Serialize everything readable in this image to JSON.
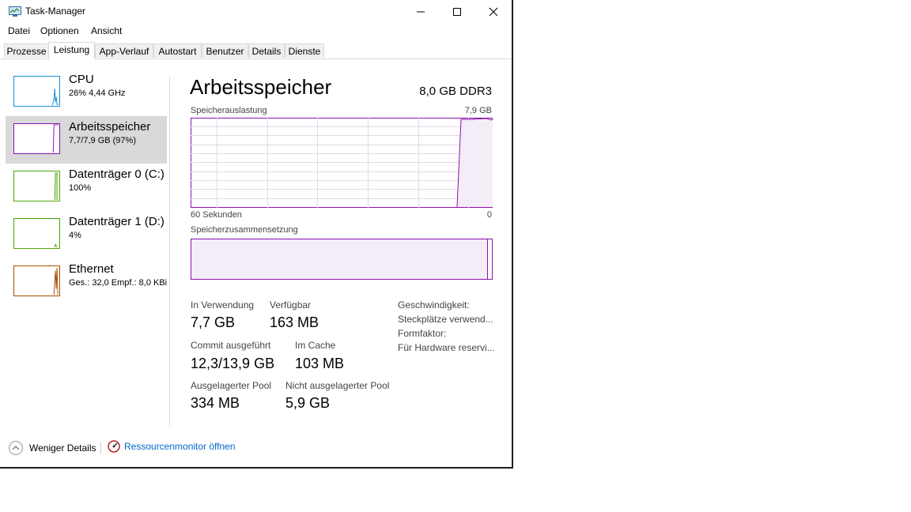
{
  "window": {
    "title": "Task-Manager",
    "icon": "task-manager-icon",
    "controls": [
      "minimize-icon",
      "maximize-icon",
      "close-icon"
    ]
  },
  "menu": {
    "file": "Datei",
    "options": "Optionen",
    "view": "Ansicht"
  },
  "tabs": [
    {
      "label": "Prozesse",
      "active": false
    },
    {
      "label": "Leistung",
      "active": true
    },
    {
      "label": "App-Verlauf",
      "active": false
    },
    {
      "label": "Autostart",
      "active": false
    },
    {
      "label": "Benutzer",
      "active": false
    },
    {
      "label": "Details",
      "active": false
    },
    {
      "label": "Dienste",
      "active": false
    }
  ],
  "sidebar": {
    "items": [
      {
        "title": "CPU",
        "subtitle": "26% 4,44 GHz",
        "color": "#1a8ed0",
        "selected": false
      },
      {
        "title": "Arbeitsspeicher",
        "subtitle": "7,7/7,9 GB (97%)",
        "color": "#8b12ae",
        "selected": true
      },
      {
        "title": "Datenträger 0 (C:)",
        "subtitle": "100%",
        "color": "#4da60c",
        "selected": false
      },
      {
        "title": "Datenträger 1 (D:)",
        "subtitle": "4%",
        "color": "#4da60c",
        "selected": false
      },
      {
        "title": "Ethernet",
        "subtitle": "Ges.: 32,0 Empf.: 8,0 KBi",
        "color": "#a74f01",
        "selected": false
      }
    ]
  },
  "main": {
    "title": "Arbeitsspeicher",
    "spec": "8,0 GB DDR3",
    "usage_graph": {
      "label": "Speicherauslastung",
      "max_label": "7,9 GB",
      "left_label": "60 Sekunden",
      "right_label": "0",
      "recent_usage_fraction": 0.97
    },
    "composition_graph": {
      "label": "Speicherzusammensetzung",
      "in_use_fraction": 0.97
    },
    "stats": {
      "in_use": {
        "label": "In Verwendung",
        "value": "7,7 GB"
      },
      "available": {
        "label": "Verfügbar",
        "value": "163 MB"
      },
      "committed": {
        "label": "Commit ausgeführt",
        "value": "12,3/13,9 GB"
      },
      "cached": {
        "label": "Im Cache",
        "value": "103 MB"
      },
      "paged_pool": {
        "label": "Ausgelagerter Pool",
        "value": "334 MB"
      },
      "nonpaged_pool": {
        "label": "Nicht ausgelagerter Pool",
        "value": "5,9 GB"
      }
    },
    "details": {
      "speed": "Geschwindigkeit:",
      "slots": "Steckplätze verwend...",
      "form_factor": "Formfaktor:",
      "hw_reserved": "Für Hardware reservi..."
    },
    "accent_color": "#8b12ae"
  },
  "footer": {
    "fewer_details": "Weniger Details",
    "resource_monitor": "Ressourcenmonitor öffnen",
    "link_color": "#0066cc"
  }
}
